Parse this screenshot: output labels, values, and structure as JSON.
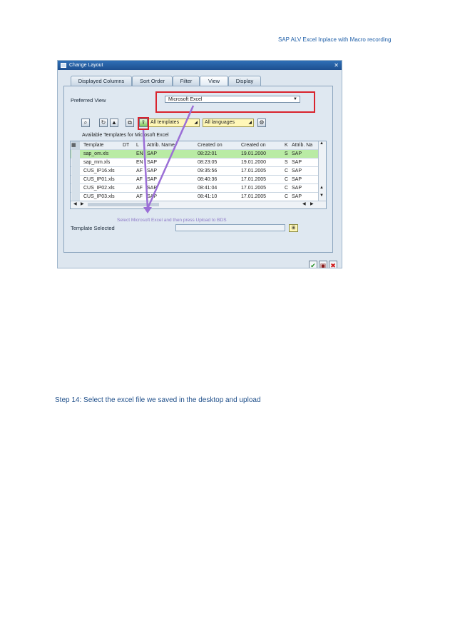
{
  "header": "SAP ALV Excel Inplace with Macro recording",
  "dialog": {
    "title": "Change Layout",
    "tabs": [
      "Displayed Columns",
      "Sort Order",
      "Filter",
      "View",
      "Display"
    ],
    "active_tab": "View",
    "preferred_view_label": "Preferred View",
    "preferred_view_value": "Microsoft Excel",
    "toolbar_dropdowns": [
      "All templates",
      "All languages"
    ],
    "list_title": "Available Templates for Microsoft Excel",
    "columns": [
      "Template",
      "DT",
      "L",
      "Attrib. Name",
      "Created on",
      "Created on",
      "K",
      "Attrib. Na"
    ],
    "rows": [
      [
        "sap_om.xls",
        "",
        "EN",
        "SAP",
        "08:22:01",
        "19.01.2000",
        "S",
        "SAP"
      ],
      [
        "sap_mm.xls",
        "",
        "EN",
        "SAP",
        "08:23:05",
        "19.01.2000",
        "S",
        "SAP"
      ],
      [
        "CUS_IP16.xls",
        "",
        "AF",
        "SAP",
        "09:35:56",
        "17.01.2005",
        "C",
        "SAP"
      ],
      [
        "CUS_IP01.xls",
        "",
        "AF",
        "SAP",
        "08:40:36",
        "17.01.2005",
        "C",
        "SAP"
      ],
      [
        "CUS_IP02.xls",
        "",
        "AF",
        "SAP",
        "08:41:04",
        "17.01.2005",
        "C",
        "SAP"
      ],
      [
        "CUS_IP03.xls",
        "",
        "AF",
        "SAP",
        "08:41:10",
        "17.01.2005",
        "C",
        "SAP"
      ]
    ],
    "instruction": "Select Microsoft Excel and then press Upload to BDS",
    "template_selected_label": "Template Selected",
    "template_selected_value": ""
  },
  "step_text": "Step 14: Select the excel file we saved in the desktop and upload",
  "colors": {
    "highlight_box": "#d9232d",
    "arrow": "#9b6fd6",
    "selected_row": "#b9eba4",
    "text_blue": "#1f5fa8"
  }
}
